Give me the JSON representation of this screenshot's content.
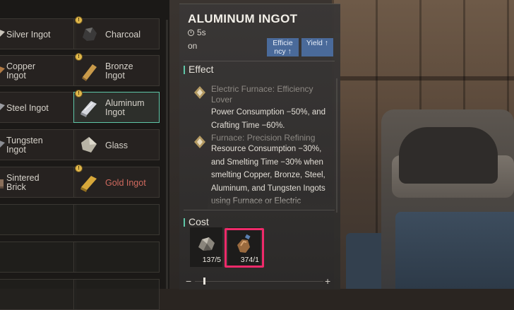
{
  "recipes": {
    "left_column": [
      {
        "label": "Silver Ingot",
        "icon": "silver-ingot-icon"
      },
      {
        "label": "Copper\nIngot",
        "icon": "copper-ingot-icon"
      },
      {
        "label": "Steel Ingot",
        "icon": "steel-ingot-icon"
      },
      {
        "label": "Tungsten\nIngot",
        "icon": "tungsten-ingot-icon"
      },
      {
        "label": "Sintered\nBrick",
        "icon": "sintered-brick-icon"
      }
    ],
    "right_column": [
      {
        "label": "Charcoal",
        "icon": "charcoal-icon"
      },
      {
        "label": "Bronze\nIngot",
        "icon": "bronze-ingot-icon"
      },
      {
        "label": "Aluminum\nIngot",
        "icon": "aluminum-ingot-icon",
        "selected": true
      },
      {
        "label": "Glass",
        "icon": "glass-icon"
      },
      {
        "label": "Gold Ingot",
        "icon": "gold-ingot-icon",
        "locked": true
      }
    ]
  },
  "detail": {
    "title": "ALUMINUM INGOT",
    "time": "5s",
    "on_label": "on",
    "tags": [
      "Efficie ncy ↑",
      "Yield ↑"
    ],
    "effect_heading": "Effect",
    "effects": [
      {
        "title": "Electric Furnace: Efficiency Lover",
        "text": "Power Consumption −50%, and Crafting Time −60%."
      },
      {
        "title": "Furnace: Precision Refining",
        "text": "Resource Consumption −30%, and Smelting Time −30% when smelting Copper, Bronze, Steel, Aluminum, and Tungsten Ingots using Furnace or Electric"
      }
    ],
    "cost_heading": "Cost",
    "costs": [
      {
        "count": "137/5",
        "icon": "ore-icon"
      },
      {
        "count": "374/1",
        "icon": "bottle-icon"
      }
    ],
    "zoom_minus": "−",
    "zoom_plus": "+",
    "zoom_level": 0.05
  },
  "colors": {
    "accent": "#5fc7a8",
    "highlight": "#ef2a6a",
    "tag": "#4a6a9a",
    "locked_text": "#d06a5e"
  }
}
